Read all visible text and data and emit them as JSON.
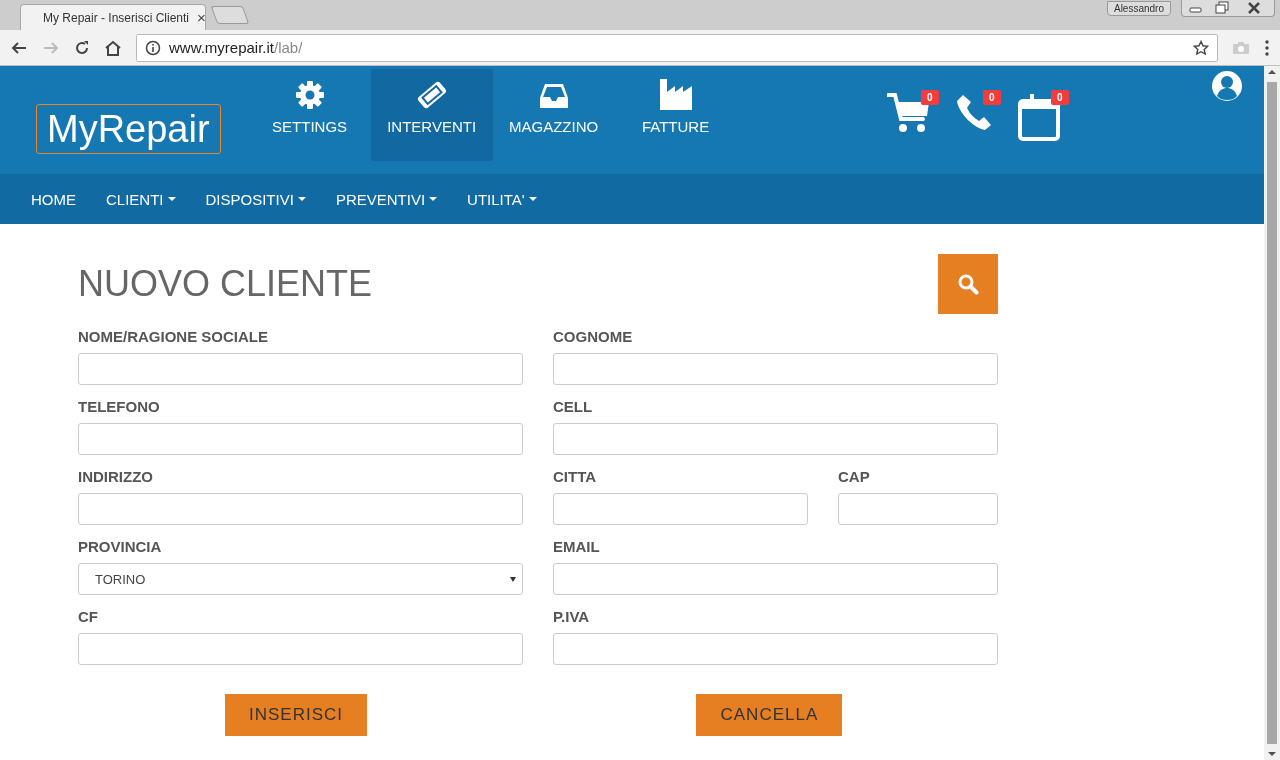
{
  "browser": {
    "tab_title": "My Repair - Inserisci Clienti",
    "tab_close": "×",
    "user": "Alessandro",
    "url_host": "www.myrepair.it",
    "url_path": "/lab/"
  },
  "header": {
    "logo": "MyRepair",
    "modules": [
      {
        "label": "SETTINGS",
        "selected": false
      },
      {
        "label": "INTERVENTI",
        "selected": true
      },
      {
        "label": "MAGAZZINO",
        "selected": false
      },
      {
        "label": "FATTURE",
        "selected": false
      }
    ],
    "counters": [
      "0",
      "0",
      "0"
    ]
  },
  "nav": [
    {
      "label": "HOME",
      "dropdown": false
    },
    {
      "label": "CLIENTI",
      "dropdown": true
    },
    {
      "label": "DISPOSITIVI",
      "dropdown": true
    },
    {
      "label": "PREVENTIVI",
      "dropdown": true
    },
    {
      "label": "UTILITA'",
      "dropdown": true
    }
  ],
  "form": {
    "title": "NUOVO CLIENTE",
    "rows": [
      [
        {
          "label": "NOME/RAGIONE SOCIALE",
          "kind": "text"
        },
        {
          "label": "COGNOME",
          "kind": "text"
        }
      ],
      [
        {
          "label": "TELEFONO",
          "kind": "text"
        },
        {
          "label": "CELL",
          "kind": "text"
        }
      ],
      [
        {
          "label": "INDIRIZZO",
          "kind": "text"
        },
        {
          "label": "CITTA",
          "kind": "text"
        },
        {
          "label": "CAP",
          "kind": "text"
        }
      ],
      [
        {
          "label": "PROVINCIA",
          "kind": "select",
          "value": "TORINO"
        },
        {
          "label": "EMAIL",
          "kind": "text"
        }
      ],
      [
        {
          "label": "CF",
          "kind": "text"
        },
        {
          "label": "P.IVA",
          "kind": "text"
        }
      ]
    ],
    "buttons": [
      "INSERISCI",
      "CANCELLA"
    ]
  }
}
